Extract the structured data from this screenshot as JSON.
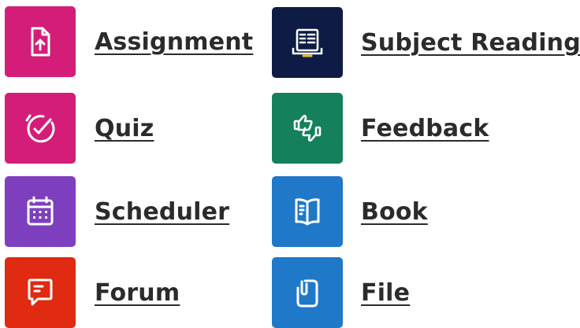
{
  "activities": {
    "assignment": {
      "label": "Assignment",
      "color": "#d31d78",
      "icon": "assignment-icon"
    },
    "quiz": {
      "label": "Quiz",
      "color": "#d31d78",
      "icon": "quiz-icon"
    },
    "scheduler": {
      "label": "Scheduler",
      "color": "#7d3fbe",
      "icon": "calendar-icon"
    },
    "forum": {
      "label": "Forum",
      "color": "#e02a12",
      "icon": "forum-icon"
    },
    "subject_readings": {
      "label": "Subject Readings",
      "color": "#0e1b45",
      "icon": "readings-icon"
    },
    "feedback": {
      "label": "Feedback",
      "color": "#14805c",
      "icon": "feedback-icon"
    },
    "book": {
      "label": "Book",
      "color": "#1f78c8",
      "icon": "book-icon"
    },
    "file": {
      "label": "File",
      "color": "#1f78c8",
      "icon": "file-icon"
    }
  }
}
